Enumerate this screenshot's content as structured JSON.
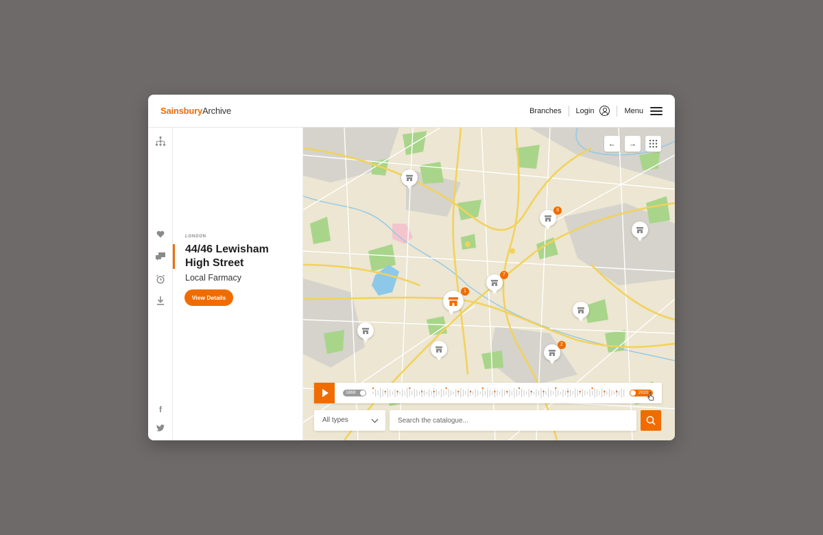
{
  "header": {
    "logo_brand": "Sainsbury",
    "logo_rest": "Archive",
    "nav": {
      "branches": "Branches",
      "login": "Login",
      "menu": "Menu"
    }
  },
  "rail": {
    "icons": [
      "sitemap-icon",
      "heart-icon",
      "chat-icon",
      "alarm-icon",
      "download-icon",
      "facebook-icon",
      "twitter-icon"
    ],
    "facebook_glyph": "f",
    "twitter_glyph": "t"
  },
  "detail": {
    "city": "LONDON",
    "title": "44/46 Lewisham High Street",
    "subtitle": "Local Farmacy",
    "button": "View Details"
  },
  "map": {
    "controls": {
      "back": "←",
      "forward": "→"
    },
    "markers": [
      {
        "badge": ""
      },
      {
        "badge": "3"
      },
      {
        "badge": ""
      },
      {
        "badge": "7"
      },
      {
        "badge": "1",
        "selected": true
      },
      {
        "badge": ""
      },
      {
        "badge": ""
      },
      {
        "badge": ""
      },
      {
        "badge": "2"
      }
    ]
  },
  "timeline": {
    "start_year": "1869",
    "end_year": "2020"
  },
  "filter": {
    "type_value": "All types",
    "search_placeholder": "Search the catalogue..."
  },
  "colors": {
    "accent": "#f06c00",
    "map_bg": "#ece6d2",
    "park": "#a8d58a",
    "water": "#8ec8e8",
    "road": "#f2d25a"
  }
}
